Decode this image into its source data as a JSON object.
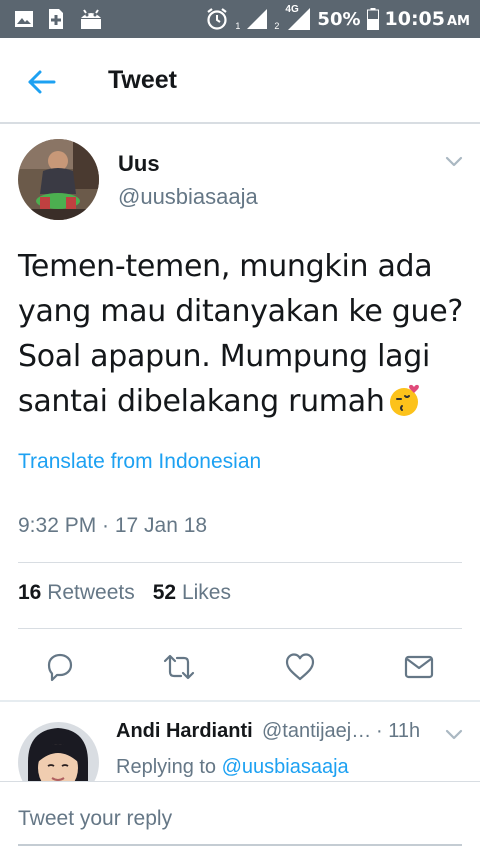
{
  "status_bar": {
    "signal_sim1": "1",
    "signal_sim2": "2",
    "network_type": "4G",
    "battery": "50%",
    "time": "10:05",
    "ampm": "AM"
  },
  "header": {
    "title": "Tweet",
    "back_icon": "arrow-left-icon"
  },
  "tweet": {
    "author_name": "Uus",
    "author_handle": "@uusbiasaaja",
    "text_lines": [
      "Temen-temen, mungkin ada",
      "yang mau ditanyakan ke gue?",
      "Soal apapun. Mumpung lagi",
      "santai dibelakang rumah"
    ],
    "emoji": "kissing-face-heart-emoji",
    "translate_link": "Translate from Indonesian",
    "timestamp": "9:32 PM · 17 Jan 18",
    "retweets_count": "16",
    "retweets_label": "Retweets",
    "likes_count": "52",
    "likes_label": "Likes"
  },
  "actions": [
    "reply-icon",
    "retweet-icon",
    "like-icon",
    "direct-message-icon"
  ],
  "reply": {
    "name": "Andi Hardianti",
    "handle": "@tantijaej…",
    "time": "· 11h",
    "replying_prefix": "Replying to",
    "replying_to": "@uusbiasaaja"
  },
  "compose": {
    "placeholder": "Tweet your reply"
  },
  "colors": {
    "accent": "#1da1f2",
    "status_bar": "#5b6670",
    "secondary_text": "#657786",
    "primary_text": "#14171a",
    "divider": "#d8dde2"
  }
}
